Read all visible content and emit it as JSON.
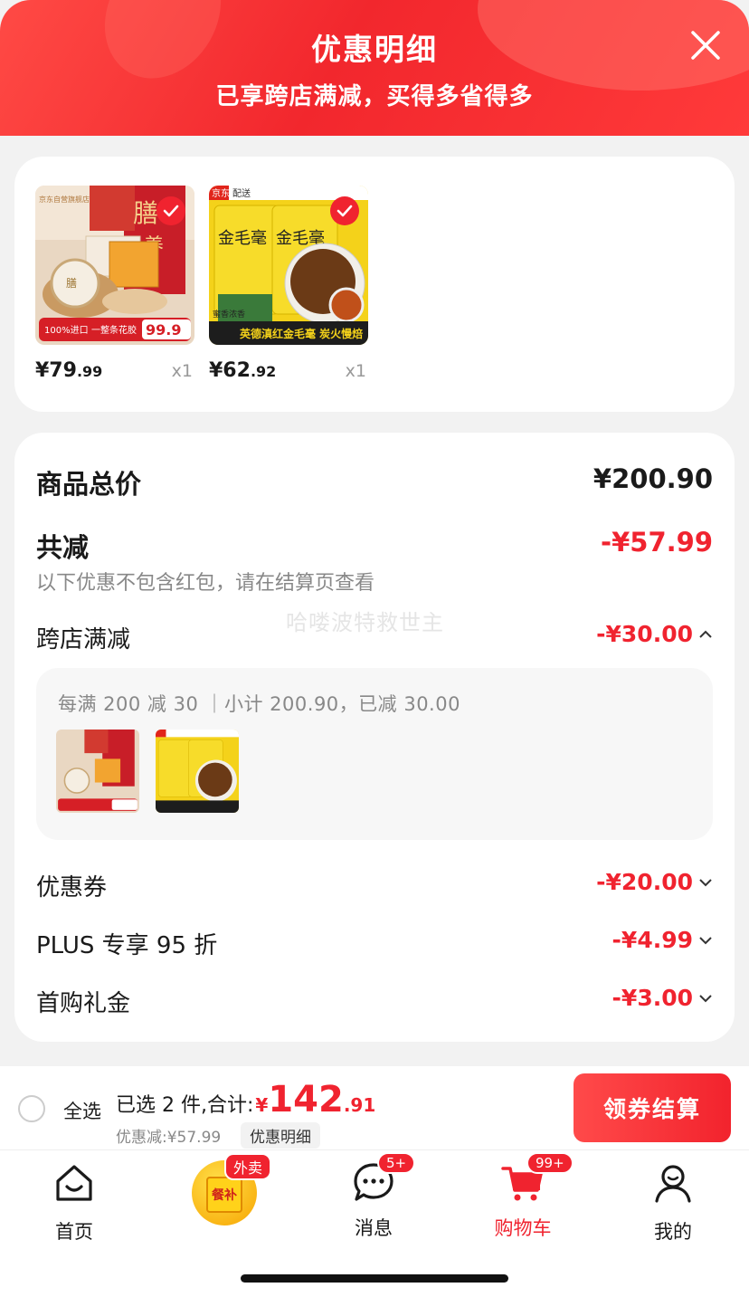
{
  "header": {
    "title": "优惠明细",
    "subtitle": "已享跨店满减，买得多省得多",
    "close_icon": "close-icon"
  },
  "products": [
    {
      "price_int": "¥79",
      "price_dec": ".99",
      "qty": "x1",
      "selected": true,
      "image": "gift-box-product",
      "bottom_text": "一整条花胶"
    },
    {
      "price_int": "¥62",
      "price_dec": ".92",
      "qty": "x1",
      "selected": true,
      "image": "black-tea-tin",
      "bottom_text": "英德滇红金毛毫 炭火慢焙",
      "badge": "京东 配送"
    }
  ],
  "summary": {
    "total_label": "商品总价",
    "total_value": "¥200.90",
    "reduce_label": "共减",
    "reduce_value": "-¥57.99",
    "reduce_note": "以下优惠不包含红包，请在结算页查看",
    "watermark": "哈喽波特救世主",
    "cross_store": {
      "label": "跨店满减",
      "value": "-¥30.00",
      "expanded": true
    },
    "rule_text": "每满 200 减 30 ｜小计 200.90，已减 30.00",
    "coupon": {
      "label": "优惠券",
      "value": "-¥20.00"
    },
    "plus": {
      "label": "PLUS 专享 95 折",
      "value": "-¥4.99"
    },
    "first_buy": {
      "label": "首购礼金",
      "value": "-¥3.00"
    }
  },
  "bottom_bar": {
    "select_all": "全选",
    "selected_text": "已选 2 件,合计:",
    "currency": "¥",
    "total_int": "142",
    "total_dec": ".91",
    "discount_text": "优惠减:¥57.99",
    "detail_tag": "优惠明细",
    "checkout": "领券结算"
  },
  "tabs": [
    {
      "label": "首页",
      "icon": "home-icon"
    },
    {
      "label": "外卖",
      "sub": "餐补",
      "icon": "meal-bag-icon"
    },
    {
      "label": "消息",
      "icon": "message-icon",
      "badge": "5+"
    },
    {
      "label": "购物车",
      "icon": "cart-icon",
      "badge": "99+",
      "active": true
    },
    {
      "label": "我的",
      "icon": "user-icon"
    }
  ],
  "colors": {
    "accent": "#f0232f",
    "header": "#f2272d"
  }
}
